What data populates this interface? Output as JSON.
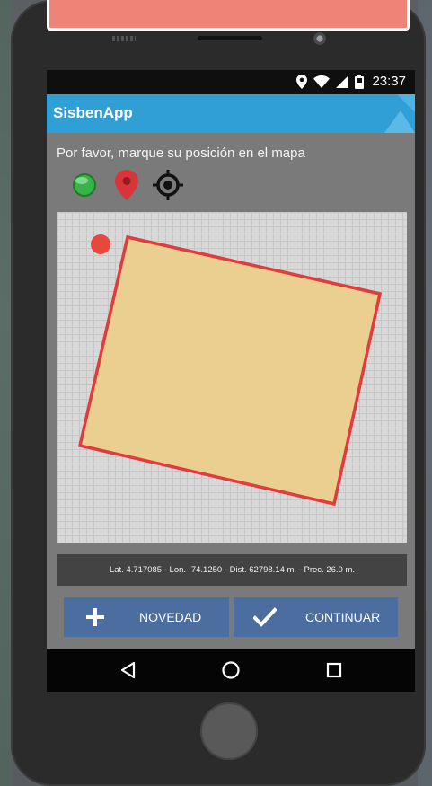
{
  "app": {
    "title": "SisbenApp",
    "accent_color": "#2f9fd6"
  },
  "status_bar": {
    "time": "23:37",
    "icons": [
      "location-icon",
      "wifi-icon",
      "signal-icon",
      "battery-icon"
    ]
  },
  "instruction": "Por favor, marque su posición en el mapa",
  "toolbar": {
    "tools": [
      {
        "name": "gps-status-icon",
        "color": "#2e9e3a"
      },
      {
        "name": "map-marker-icon",
        "color": "#d9343a"
      },
      {
        "name": "my-location-icon",
        "color": "#111111"
      }
    ]
  },
  "map": {
    "polygon_fill": "#ebcf90",
    "polygon_stroke": "#e03c3c",
    "position_dot_color": "#e8473d"
  },
  "coords_text": "Lat. 4.717085 - Lon. -74.1250 - Dist. 62798.14 m. - Prec. 26.0 m.",
  "buttons": {
    "novedad": {
      "label": "NOVEDAD",
      "icon": "plus-icon"
    },
    "continuar": {
      "label": "CONTINUAR",
      "icon": "check-icon"
    }
  },
  "nav_bar": {
    "items": [
      "back-icon",
      "home-icon",
      "recent-apps-icon"
    ]
  }
}
